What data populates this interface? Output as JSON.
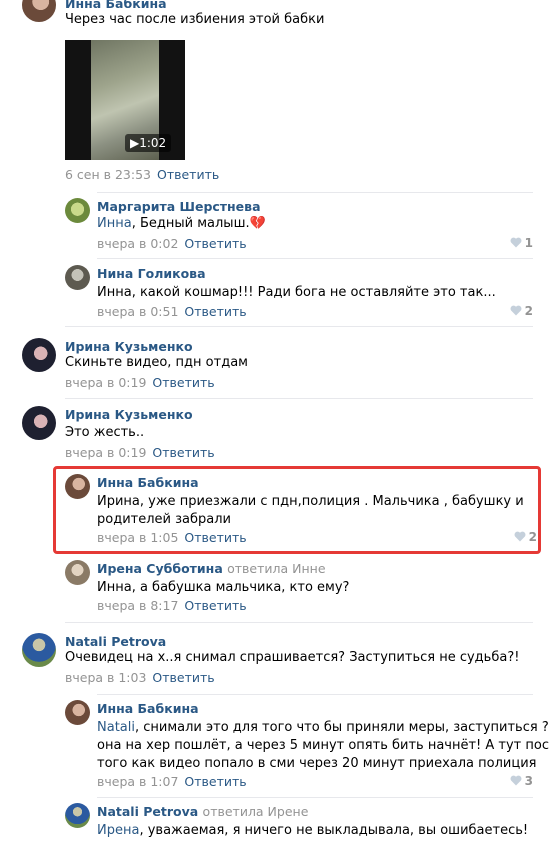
{
  "reply_label": "Ответить",
  "c1": {
    "author": "Инна Бабкина",
    "text": "Через час после избиения этой бабки",
    "video_duration": "1:02",
    "date": "6 сен в 23:53"
  },
  "r1": {
    "author": "Маргарита Шерстнева",
    "mention": "Инна",
    "text": ", Бедный малыш.",
    "emoji": "💔",
    "date": "вчера в 0:02",
    "likes": "1"
  },
  "r2": {
    "author": "Нина Голикова",
    "text": "Инна, какой кошмар!!! Ради бога не оставляйте это так...",
    "date": "вчера в 0:51",
    "likes": "2"
  },
  "c2": {
    "author": "Ирина Кузьменко",
    "text": "Скиньте видео, пдн отдам",
    "date": "вчера в 0:19"
  },
  "c3": {
    "author": "Ирина Кузьменко",
    "text": "Это жесть..",
    "date": "вчера в 0:19"
  },
  "r3": {
    "author": "Инна Бабкина",
    "line1": "Ирина, уже приезжали с пдн,полиция . Мальчика , бабушку и",
    "line2": "родителей забрали",
    "date": "вчера в 1:05",
    "likes": "2"
  },
  "r4": {
    "author": "Ирена Субботина",
    "replied_to": "ответила Инне",
    "text": "Инна, а бабушка мальчика, кто ему?",
    "date": "вчера в 8:17"
  },
  "c4": {
    "author": "Natali Petrova",
    "text": "Очевидец на х..я снимал спрашивается? Заступиться не судьба?!",
    "date": "вчера в 1:03"
  },
  "r5": {
    "author": "Инна Бабкина",
    "mention": "Natali",
    "line1": ", снимали это для того что бы приняли меры, заступиться ? Ну",
    "line2": "она на хер пошлёт, а через 5 минут опять бить начнёт! А тут после",
    "line3": "того как видео попало в сми через 20 минут приехала полиция",
    "date": "вчера в 1:07",
    "likes": "3"
  },
  "r6": {
    "author": "Natali Petrova",
    "replied_to": "ответила Ирене",
    "mention": "Ирена",
    "text": ", уважаемая, я ничего не выкладывала, вы ошибаетесь!"
  }
}
